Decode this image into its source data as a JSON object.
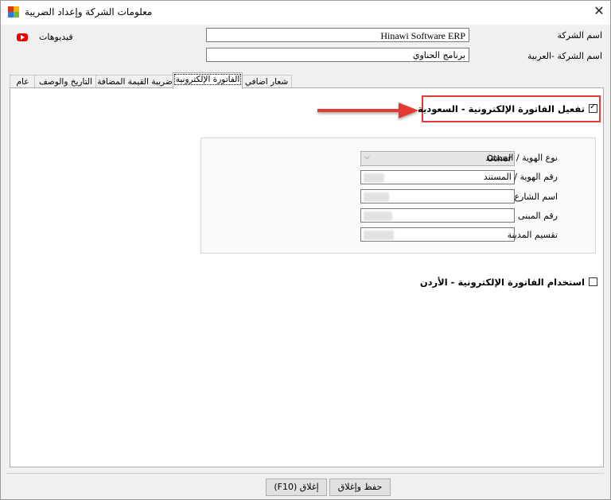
{
  "window": {
    "title": "معلومات الشركة وإعداد الضريبة",
    "close_glyph": "✕"
  },
  "videos": {
    "label": "فيديوهات",
    "icon": "youtube-icon"
  },
  "company": {
    "name_label": "اسم الشركة",
    "name_value": "Hinawi Software ERP",
    "arabic_name_label": "اسم الشركة -العربية",
    "arabic_name_value": "برنامج الحناوي"
  },
  "tabs": [
    {
      "label": "عام"
    },
    {
      "label": "التاريخ والوصف"
    },
    {
      "label": "ضريبة القيمة المضافة"
    },
    {
      "label": "الفاتورة الإلكترونية"
    },
    {
      "label": "شعار اضافي"
    }
  ],
  "einvoice": {
    "saudi_checkbox_label": "تفعيل الفاتورة الإلكترونية - السعودية",
    "saudi_checked": true,
    "fields": {
      "id_type_label": "نوع الهوية / المستند",
      "id_type_value": "Other",
      "id_number_label": "رقم الهوية / المستند",
      "street_label": "اسم الشارع",
      "building_label": "رقم المبنى",
      "district_label": "تقسيم المدينة"
    },
    "jordan_checkbox_label": "استخدام الفاتورة الإلكترونية - الأردن",
    "jordan_checked": false
  },
  "buttons": {
    "save_close": "حفظ وإغلاق",
    "close": "إغلاق (F10)"
  },
  "colors": {
    "highlight": "#e53935"
  }
}
